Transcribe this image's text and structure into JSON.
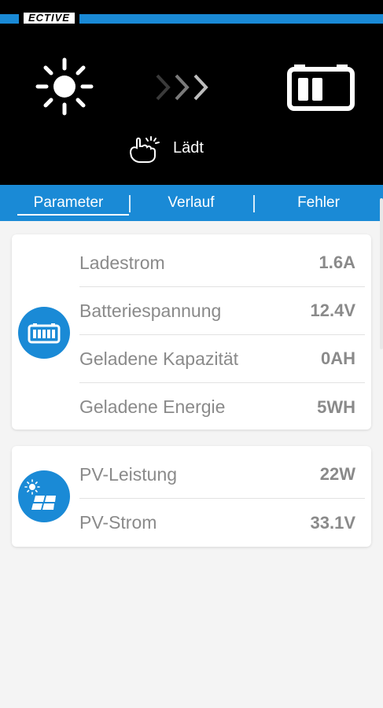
{
  "brand": {
    "name": "ECTIVE"
  },
  "header": {
    "status_text": "Lädt",
    "source_icon": "sun-icon",
    "flow_icon": "chevrons-right-icon",
    "target_icon": "battery-icon",
    "status_icon": "touch-hand-icon"
  },
  "colors": {
    "accent": "#1a8ad6",
    "header_bg": "#000000",
    "label": "#8a8a8a"
  },
  "tabs": [
    {
      "label": "Parameter",
      "active": true
    },
    {
      "label": "Verlauf",
      "active": false
    },
    {
      "label": "Fehler",
      "active": false
    }
  ],
  "battery_card": {
    "icon": "battery-icon",
    "rows": [
      {
        "label": "Ladestrom",
        "value": "1.6A"
      },
      {
        "label": "Batteriespannung",
        "value": "12.4V"
      },
      {
        "label": "Geladene Kapazität",
        "value": "0AH"
      },
      {
        "label": "Geladene Energie",
        "value": "5WH"
      }
    ]
  },
  "pv_card": {
    "icon": "solar-panel-icon",
    "rows": [
      {
        "label": "PV-Leistung",
        "value": "22W"
      },
      {
        "label": "PV-Strom",
        "value": "33.1V"
      }
    ]
  }
}
